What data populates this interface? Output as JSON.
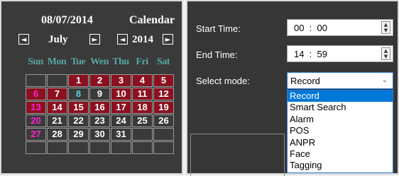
{
  "calendar": {
    "date_text": "08/07/2014",
    "title": "Calendar",
    "month": "July",
    "year": "2014",
    "prev_month_icon": "◄",
    "next_month_icon": "►",
    "prev_year_icon": "◄",
    "next_year_icon": "►",
    "weekdays": [
      "Sun",
      "Mon",
      "Tue",
      "Wen",
      "Thu",
      "Fri",
      "Sat"
    ],
    "grid": [
      [
        "",
        "",
        "1",
        "2",
        "3",
        "4",
        "5"
      ],
      [
        "6",
        "7",
        "8",
        "9",
        "10",
        "11",
        "12"
      ],
      [
        "13",
        "14",
        "15",
        "16",
        "17",
        "18",
        "19"
      ],
      [
        "20",
        "21",
        "22",
        "23",
        "24",
        "25",
        "26"
      ],
      [
        "27",
        "28",
        "29",
        "30",
        "31",
        "",
        ""
      ],
      [
        "",
        "",
        "",
        "",
        "",
        "",
        ""
      ]
    ],
    "colors": {
      "recorded_day": "#8c1120",
      "weekend_text": "#ff23d2",
      "selected_text": "#4fd0d8",
      "weekday_header": "#57a6a2"
    }
  },
  "form": {
    "start_time_label": "Start Time:",
    "start_time_value": "00  :  00",
    "end_time_label": "End Time:",
    "end_time_value": "14  :  59",
    "select_mode_label": "Select mode:",
    "select_mode_value": "Record",
    "options": [
      "Record",
      "Smart Search",
      "Alarm",
      "POS",
      "ANPR",
      "Face",
      "Tagging"
    ],
    "selected_option": "Record"
  }
}
